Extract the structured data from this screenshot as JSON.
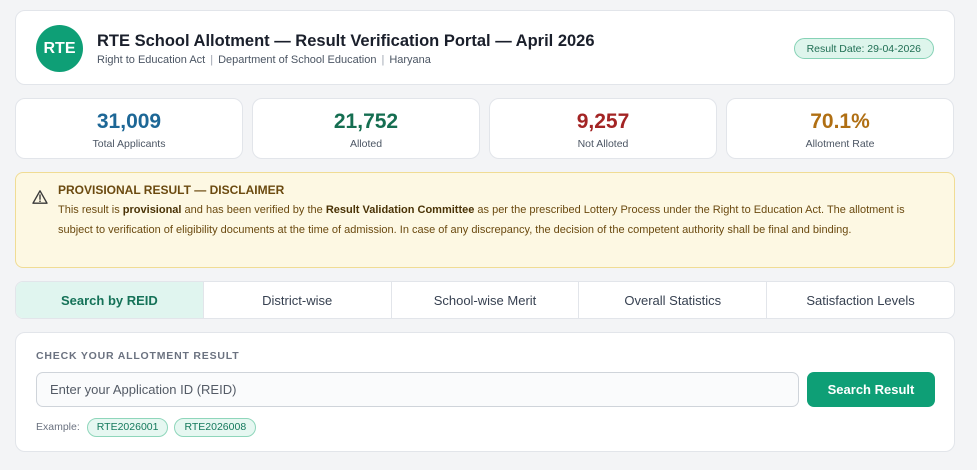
{
  "header": {
    "logo_text": "RTE",
    "title": "RTE School Allotment — Result Verification Portal — April 2026",
    "subtitle_parts": [
      "Right to Education Act",
      "Department of School Education",
      "Haryana"
    ],
    "result_date": "Result Date: 29-04-2026"
  },
  "stats": [
    {
      "value": "31,009",
      "label": "Total Applicants",
      "color": "#1d6796"
    },
    {
      "value": "21,752",
      "label": "Alloted",
      "color": "#156e51"
    },
    {
      "value": "9,257",
      "label": "Not Alloted",
      "color": "#a32424"
    },
    {
      "value": "70.1%",
      "label": "Allotment Rate",
      "color": "#b06f13"
    }
  ],
  "disclaimer": {
    "icon": "warning-icon",
    "title": "PROVISIONAL RESULT — DISCLAIMER",
    "text_1": "This result is ",
    "text_bold_1": "provisional",
    "text_2": " and has been verified by the ",
    "text_bold_2": "Result Validation Committee",
    "text_3": " as per the prescribed Lottery Process under the Right to Education Act. The allotment is subject to verification of eligibility documents at the time of admission. In case of any discrepancy, the decision of the competent authority shall be final and binding."
  },
  "tabs": [
    {
      "label": "Search by REID",
      "active": true
    },
    {
      "label": "District-wise",
      "active": false
    },
    {
      "label": "School-wise Merit",
      "active": false
    },
    {
      "label": "Overall Statistics",
      "active": false
    },
    {
      "label": "Satisfaction Levels",
      "active": false
    }
  ],
  "search": {
    "section_label": "CHECK YOUR ALLOTMENT RESULT",
    "placeholder": "Enter your Application ID (REID)",
    "value": "",
    "button_label": "Search Result",
    "example_label": "Example:",
    "examples": [
      "RTE2026001",
      "RTE2026008"
    ]
  },
  "colors": {
    "accent": "#0e9f76",
    "warning_bg": "#fdf8e3",
    "warning_text": "#6b4a10"
  }
}
